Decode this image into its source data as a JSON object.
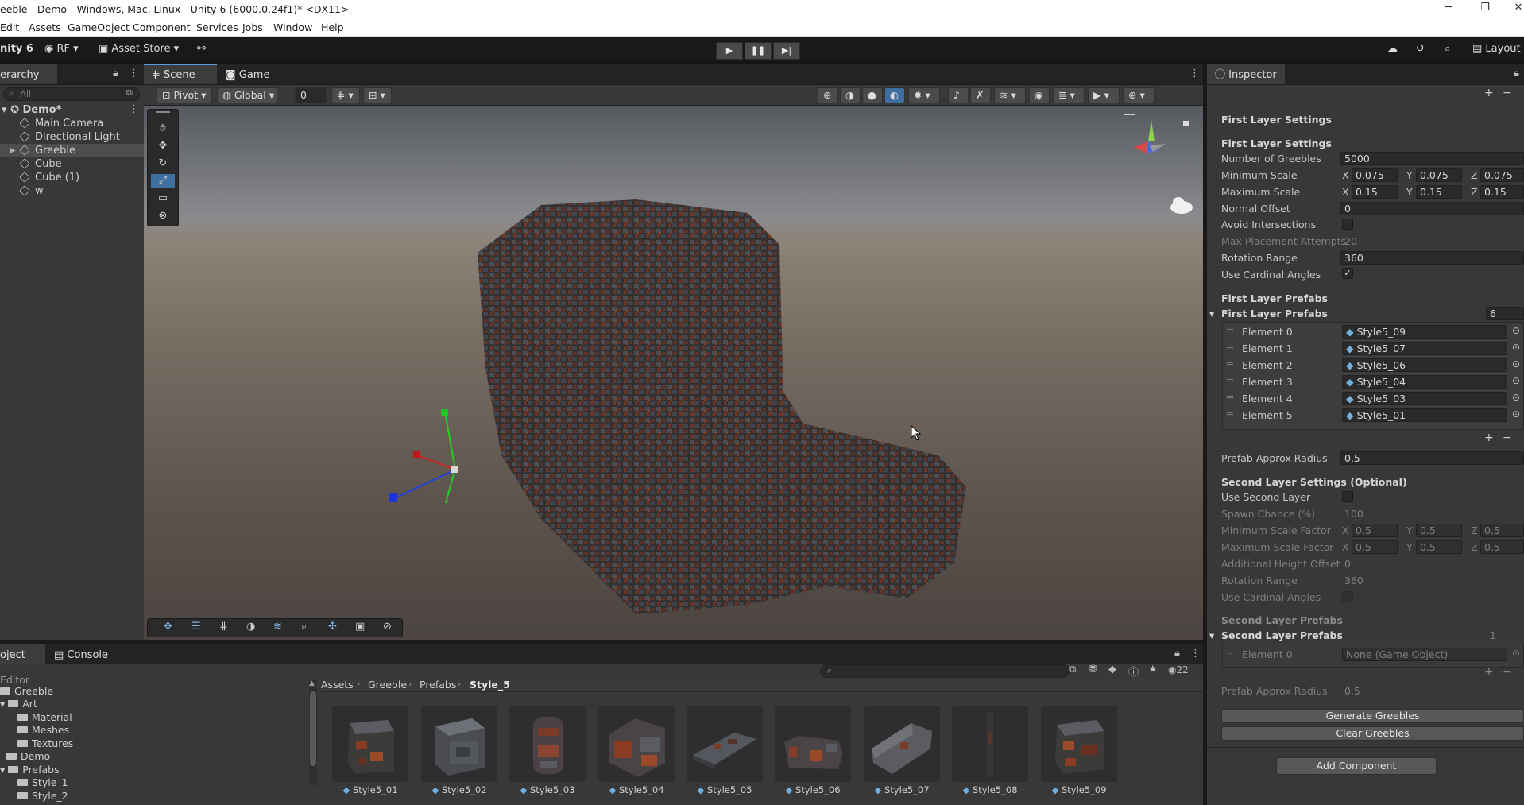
{
  "window": {
    "title": "eeble - Demo - Windows, Mac, Linux - Unity 6 (6000.0.24f1)* <DX11>"
  },
  "menu": [
    "Edit",
    "Assets",
    "GameObject",
    "Component",
    "Services",
    "Jobs",
    "Window",
    "Help"
  ],
  "toolbar": {
    "product": "nity 6",
    "account": "RF",
    "asset_store": "Asset Store",
    "layout": "Layout"
  },
  "hierarchy": {
    "tab": "erarchy",
    "search_placeholder": "All",
    "scene": "Demo*",
    "items": [
      "Main Camera",
      "Directional Light",
      "Greeble",
      "Cube",
      "Cube (1)",
      "w"
    ]
  },
  "scene_tabs": {
    "scene": "Scene",
    "game": "Game"
  },
  "scene_toolbar": {
    "pivot": "Pivot",
    "global": "Global",
    "grid_value": "0"
  },
  "inspector": {
    "tab": "Inspector",
    "section1": "First Layer Settings",
    "sub1": "First Layer Settings",
    "number_label": "Number of Greebles",
    "number_value": "5000",
    "min_scale_label": "Minimum Scale",
    "min_scale": {
      "x": "0.075",
      "y": "0.075",
      "z": "0.075"
    },
    "max_scale_label": "Maximum Scale",
    "max_scale": {
      "x": "0.15",
      "y": "0.15",
      "z": "0.15"
    },
    "normal_offset_label": "Normal Offset",
    "normal_offset": "0",
    "avoid_label": "Avoid Intersections",
    "avoid_checked": false,
    "max_attempts_label": "Max Placement Attempts",
    "max_attempts": "20",
    "rotation_label": "Rotation Range",
    "rotation": "360",
    "cardinal_label": "Use Cardinal Angles",
    "cardinal_checked": true,
    "prefabs_header": "First Layer Prefabs",
    "prefabs_foldout": "First Layer Prefabs",
    "prefabs_count": "6",
    "elements": [
      {
        "label": "Element 0",
        "value": "Style5_09"
      },
      {
        "label": "Element 1",
        "value": "Style5_07"
      },
      {
        "label": "Element 2",
        "value": "Style5_06"
      },
      {
        "label": "Element 3",
        "value": "Style5_04"
      },
      {
        "label": "Element 4",
        "value": "Style5_03"
      },
      {
        "label": "Element 5",
        "value": "Style5_01"
      }
    ],
    "approx_label": "Prefab Approx Radius",
    "approx": "0.5",
    "section2": "Second Layer Settings (Optional)",
    "use_second_label": "Use Second Layer",
    "spawn_label": "Spawn Chance (%)",
    "spawn": "100",
    "min_factor_label": "Minimum Scale Factor",
    "min_factor": {
      "x": "0.5",
      "y": "0.5",
      "z": "0.5"
    },
    "max_factor_label": "Maximum Scale Factor",
    "max_factor": {
      "x": "0.5",
      "y": "0.5",
      "z": "0.5"
    },
    "height_label": "Additional Height Offset",
    "height": "0",
    "rotation2_label": "Rotation Range",
    "rotation2": "360",
    "cardinal2_label": "Use Cardinal Angles",
    "prefabs2_header": "Second Layer Prefabs",
    "prefabs2_foldout": "Second Layer Prefabs",
    "prefabs2_count": "1",
    "element2_label": "Element 0",
    "element2_value": "None (Game Object)",
    "approx2_label": "Prefab Approx Radius",
    "approx2": "0.5",
    "generate": "Generate Greebles",
    "clear": "Clear Greebles",
    "add_component": "Add Component"
  },
  "project": {
    "tab": "oject",
    "console": "Console",
    "hidden_count": "22",
    "breadcrumb": [
      "Assets",
      "Greeble",
      "Prefabs",
      "Style_5"
    ],
    "tree": [
      "Editor",
      "Greeble",
      "Art",
      "Material",
      "Meshes",
      "Textures",
      "Demo",
      "Prefabs",
      "Style_1",
      "Style_2"
    ],
    "assets": [
      "Style5_01",
      "Style5_02",
      "Style5_03",
      "Style5_04",
      "Style5_05",
      "Style5_06",
      "Style5_07",
      "Style5_08",
      "Style5_09"
    ]
  }
}
